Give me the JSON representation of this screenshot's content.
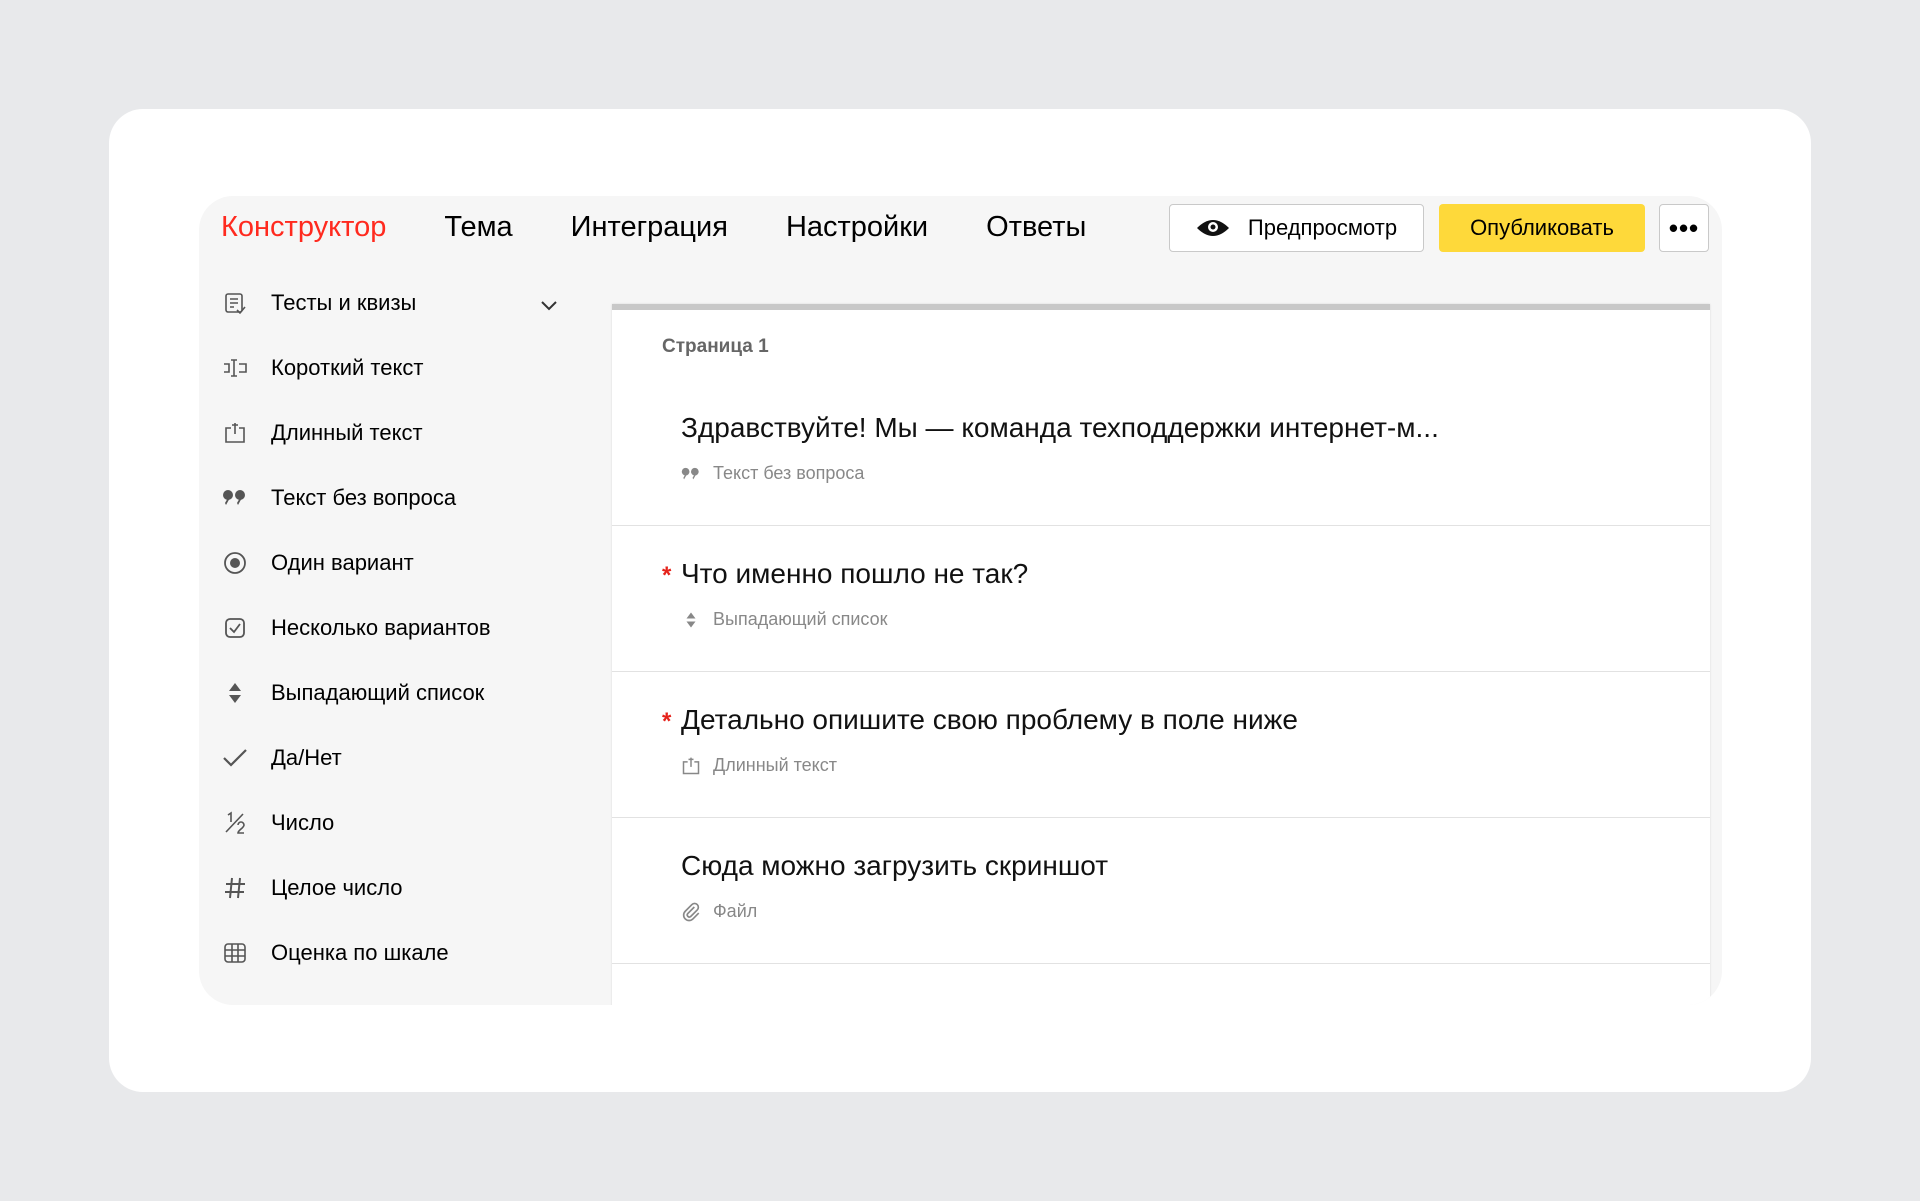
{
  "header": {
    "tabs": [
      {
        "label": "Конструктор",
        "active": true
      },
      {
        "label": "Тема"
      },
      {
        "label": "Интеграция"
      },
      {
        "label": "Настройки"
      },
      {
        "label": "Ответы"
      }
    ],
    "preview_label": "Предпросмотр",
    "publish_label": "Опубликовать",
    "more_label": "•••"
  },
  "sidebar": {
    "items": [
      {
        "label": "Тесты и квизы",
        "icon": "quiz-icon"
      },
      {
        "label": "Короткий текст",
        "icon": "short-text-icon"
      },
      {
        "label": "Длинный текст",
        "icon": "long-text-icon"
      },
      {
        "label": "Текст без вопроса",
        "icon": "quote-icon"
      },
      {
        "label": "Один вариант",
        "icon": "radio-icon"
      },
      {
        "label": "Несколько вариантов",
        "icon": "checkbox-icon"
      },
      {
        "label": "Выпадающий список",
        "icon": "dropdown-icon"
      },
      {
        "label": "Да/Нет",
        "icon": "check-icon"
      },
      {
        "label": "Число",
        "icon": "fraction-icon"
      },
      {
        "label": "Целое число",
        "icon": "hash-icon"
      },
      {
        "label": "Оценка по шкале",
        "icon": "grid-icon"
      }
    ]
  },
  "main": {
    "page_label": "Страница 1",
    "questions": [
      {
        "title": "Здравствуйте! Мы — команда техподдержки интернет-м...",
        "type": "Текст без вопроса",
        "required": false
      },
      {
        "title": "Что именно пошло не так?",
        "type": "Выпадающий список",
        "required": true
      },
      {
        "title": "Детально опишите свою проблему в поле ниже",
        "type": "Длинный текст",
        "required": true
      },
      {
        "title": "Сюда можно загрузить скриншот",
        "type": "Файл",
        "required": false
      }
    ],
    "required_mark": "*"
  },
  "colors": {
    "accent": "#ff2a1f",
    "publish": "#fed93a",
    "required": "#e5231b"
  }
}
